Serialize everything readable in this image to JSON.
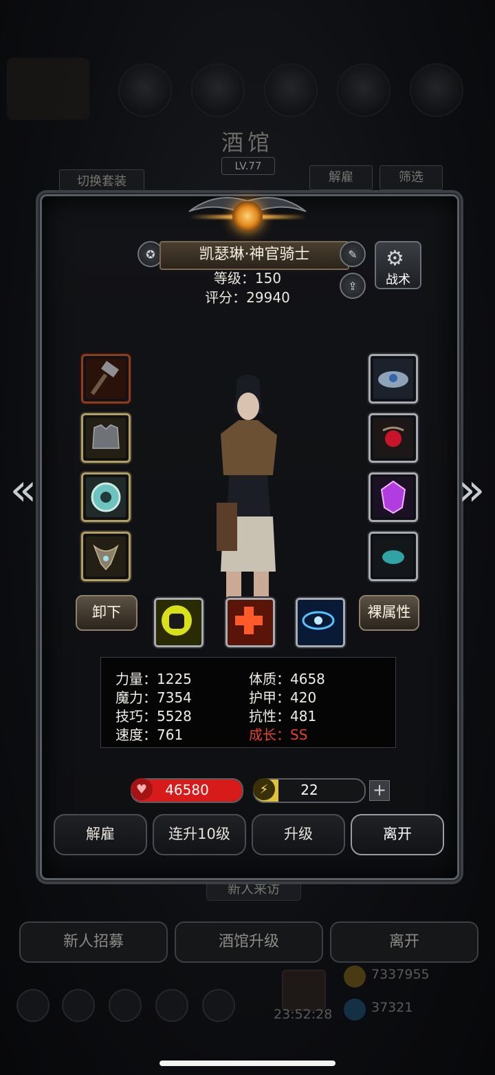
{
  "background": {
    "title": "酒馆",
    "level": "LV.77",
    "switch_outfit": "切换套装",
    "dismiss": "解雇",
    "filter": "筛选",
    "new_visitor": "新人来访",
    "buttons": [
      "新人招募",
      "酒馆升级",
      "离开"
    ],
    "gold": "7337955",
    "gems": "37321",
    "timer": "23:52:28"
  },
  "hero": {
    "name": "凯瑟琳·神官骑士",
    "level_text": "等级：150",
    "score_text": "评分：29940",
    "tactic_label": "战术"
  },
  "equipment": {
    "left": [
      {
        "icon": "hammer-icon",
        "rarity": "red"
      },
      {
        "icon": "armor-icon",
        "rarity": "gold"
      },
      {
        "icon": "gem-ring-icon",
        "rarity": "gold"
      },
      {
        "icon": "amulet-icon",
        "rarity": "gold"
      }
    ],
    "right": [
      {
        "icon": "crown-icon",
        "rarity": "white"
      },
      {
        "icon": "red-orb-relic-icon",
        "rarity": "white"
      },
      {
        "icon": "purple-crystal-icon",
        "rarity": "white"
      },
      {
        "icon": "teal-stone-icon",
        "rarity": "white"
      }
    ]
  },
  "actions_row": {
    "unequip": "卸下",
    "base_attr": "裸属性",
    "skills": [
      {
        "icon": "fist-icon"
      },
      {
        "icon": "heal-cross-icon"
      },
      {
        "icon": "eye-icon"
      }
    ]
  },
  "stats": {
    "left": [
      "力量：1225",
      "魔力：7354",
      "技巧：5528",
      "速度：761"
    ],
    "right": [
      "体质：4658",
      "护甲：420",
      "抗性：481",
      "成长：SS"
    ]
  },
  "bars": {
    "hp": {
      "value": "46580",
      "fill": 1.0
    },
    "energy": {
      "value": "22",
      "fill": 0.22
    }
  },
  "bottom_buttons": [
    "解雇",
    "连升10级",
    "升级",
    "离开"
  ],
  "colors": {
    "hp": "#d71b1b",
    "energy": "#e0c23a",
    "growth": "#e7412a",
    "gold_frame": "#b4a062"
  }
}
